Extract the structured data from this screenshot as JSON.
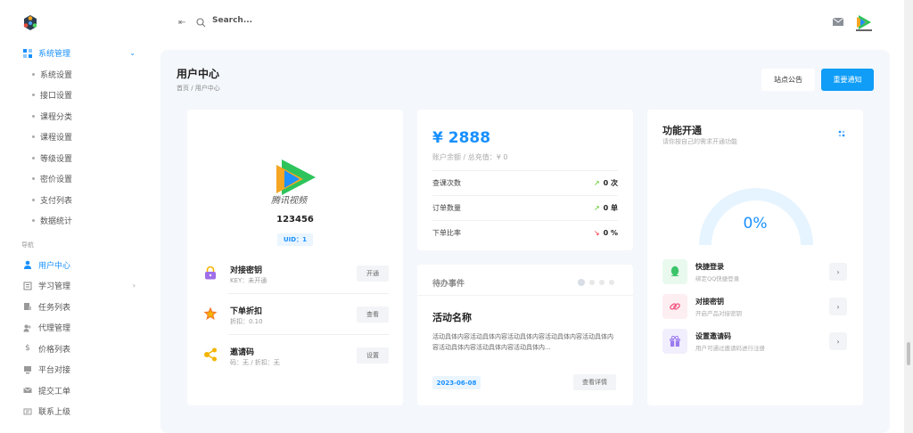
{
  "topbar": {
    "search_placeholder": "Search..."
  },
  "sidebar": {
    "system_group": "系统管理",
    "system_items": [
      "系统设置",
      "接口设置",
      "课程分类",
      "课程设置",
      "等级设置",
      "密价设置",
      "支付列表",
      "数据统计"
    ],
    "nav_label": "导航",
    "nav_items": [
      {
        "label": "用户中心",
        "icon": "user-icon"
      },
      {
        "label": "学习管理",
        "icon": "book-icon"
      },
      {
        "label": "任务列表",
        "icon": "list-icon"
      },
      {
        "label": "代理管理",
        "icon": "agent-icon"
      },
      {
        "label": "价格列表",
        "icon": "dollar-icon"
      },
      {
        "label": "平台对接",
        "icon": "platform-icon"
      },
      {
        "label": "提交工单",
        "icon": "mail-icon"
      },
      {
        "label": "联系上级",
        "icon": "contact-icon"
      }
    ]
  },
  "page": {
    "title": "用户中心",
    "breadcrumb": "首页 / 用户中心",
    "notice_button": "站点公告",
    "important_button": "重要通知"
  },
  "profile": {
    "logo_text": "腾讯视频",
    "name": "123456",
    "uid": "UID：1",
    "rows": [
      {
        "title": "对接密钥",
        "sub": "KEY：未开通",
        "button": "开通"
      },
      {
        "title": "下单折扣",
        "sub": "折扣：0.10",
        "button": "查看"
      },
      {
        "title": "邀请码",
        "sub": "码：无 / 折扣：无",
        "button": "设置"
      }
    ]
  },
  "balance": {
    "amount": "¥ 2888",
    "sub": "账户余额 / 总充值：¥ 0",
    "rows": [
      {
        "label": "查课次数",
        "value": "0 次",
        "trend": "up"
      },
      {
        "label": "订单数量",
        "value": "0 单",
        "trend": "up"
      },
      {
        "label": "下单比率",
        "value": "0 %",
        "trend": "down"
      }
    ]
  },
  "todo": {
    "title": "待办事件",
    "name": "活动名称",
    "desc": "活动具体内容活动具体内容活动具体内容活动具体内容活动具体内容活动具体内容活动具体内容活动具体内...",
    "date": "2023-06-08",
    "button": "查看详情"
  },
  "feature": {
    "title": "功能开通",
    "sub": "请你按自己的需求开通功能",
    "percent": "0%",
    "percent_value": 0,
    "rows": [
      {
        "title": "快捷登录",
        "sub": "绑定QQ快捷登录",
        "color": "#e9f9ee"
      },
      {
        "title": "对接密钥",
        "sub": "开启产品对接密钥",
        "color": "#fdeef2"
      },
      {
        "title": "设置邀请码",
        "sub": "用户可通过邀请码进行注册",
        "color": "#f1eefd"
      }
    ]
  },
  "colors": {
    "primary": "#1890ff",
    "important": "#0f9df7",
    "up": "#52c41a",
    "down": "#f5222d"
  }
}
